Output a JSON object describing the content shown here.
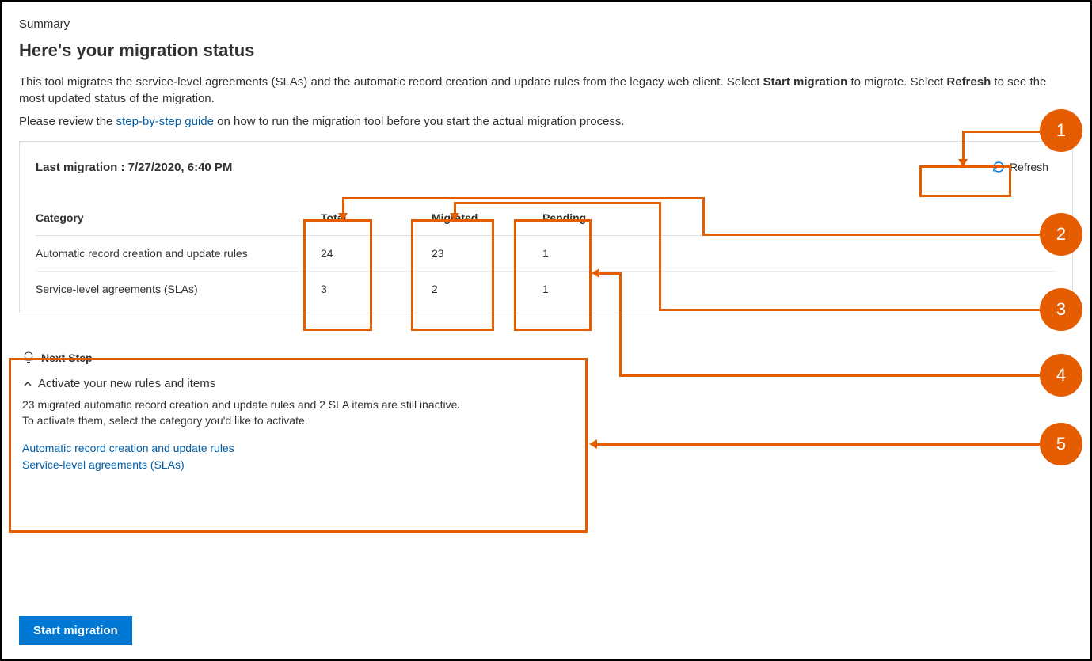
{
  "page": {
    "summary_label": "Summary",
    "title": "Here's your migration status",
    "desc_pre": "This tool migrates the service-level agreements (SLAs) and the automatic record creation and update rules from the legacy web client. Select ",
    "desc_b1": "Start migration",
    "desc_mid": " to migrate. Select ",
    "desc_b2": "Refresh",
    "desc_post": " to see the most updated status of the migration.",
    "review_pre": "Please review the ",
    "review_link": "step-by-step guide",
    "review_post": " on how to run the migration tool before you start the actual migration process."
  },
  "panel": {
    "last_migration_label": "Last migration : 7/27/2020, 6:40 PM",
    "refresh_label": "Refresh",
    "headers": {
      "category": "Category",
      "total": "Total",
      "migrated": "Migrated",
      "pending": "Pending"
    },
    "rows": [
      {
        "category": "Automatic record creation and update rules",
        "total": "24",
        "migrated": "23",
        "pending": "1"
      },
      {
        "category": "Service-level agreements (SLAs)",
        "total": "3",
        "migrated": "2",
        "pending": "1"
      }
    ]
  },
  "nextstep": {
    "label": "Next Step",
    "activate_title": "Activate your new rules and items",
    "body_l1": "23 migrated automatic record creation and update rules and 2 SLA items are still inactive.",
    "body_l2": "To activate them, select the category you'd like to activate.",
    "link1": "Automatic record creation and update rules",
    "link2": "Service-level agreements (SLAs)"
  },
  "actions": {
    "start_migration": "Start migration"
  },
  "annotations": {
    "a1": "1",
    "a2": "2",
    "a3": "3",
    "a4": "4",
    "a5": "5"
  }
}
